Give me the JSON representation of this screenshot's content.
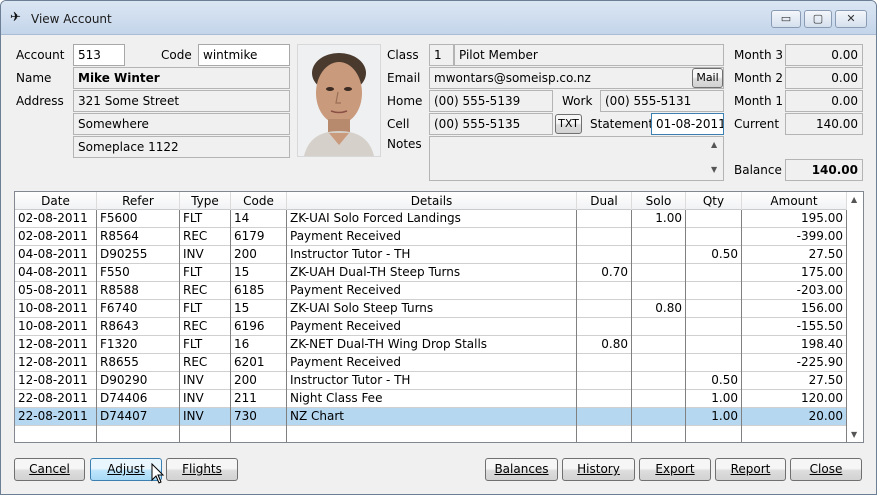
{
  "window": {
    "title": "View Account",
    "minimize": "▭",
    "maximize": "▢",
    "close": "✕"
  },
  "account": {
    "account_label": "Account",
    "account_value": "513",
    "code_label": "Code",
    "code_value": "wintmike",
    "name_label": "Name",
    "name_value": "Mike Winter",
    "address_label": "Address",
    "address_lines": [
      "321 Some Street",
      "Somewhere",
      "Someplace 1122"
    ]
  },
  "contact": {
    "class_label": "Class",
    "class_num": "1",
    "class_name": "Pilot Member",
    "email_label": "Email",
    "email_value": "mwontars@someisp.co.nz",
    "mail_button": "Mail",
    "home_label": "Home",
    "home_value": "(00) 555-5139",
    "work_label": "Work",
    "work_value": "(00) 555-5131",
    "cell_label": "Cell",
    "cell_value": "(00) 555-5135",
    "txt_button": "TXT",
    "statement_label": "Statement",
    "statement_value": "01-08-2011",
    "notes_label": "Notes",
    "notes_value": ""
  },
  "balances": {
    "month3_label": "Month 3",
    "month3_value": "0.00",
    "month2_label": "Month 2",
    "month2_value": "0.00",
    "month1_label": "Month 1",
    "month1_value": "0.00",
    "current_label": "Current",
    "current_value": "140.00",
    "balance_label": "Balance",
    "balance_value": "140.00"
  },
  "table": {
    "columns": [
      "Date",
      "Refer",
      "Type",
      "Code",
      "Details",
      "Dual",
      "Solo",
      "Qty",
      "Amount"
    ],
    "rows": [
      [
        "02-08-2011",
        "F5600",
        "FLT",
        "14",
        "ZK-UAI Solo  Forced Landings",
        "",
        "1.00",
        "",
        "195.00"
      ],
      [
        "02-08-2011",
        "R8564",
        "REC",
        "6179",
        "Payment Received",
        "",
        "",
        "",
        "-399.00"
      ],
      [
        "04-08-2011",
        "D90255",
        "INV",
        "200",
        "Instructor Tutor - TH",
        "",
        "",
        "0.50",
        "27.50"
      ],
      [
        "04-08-2011",
        "F550",
        "FLT",
        "15",
        "ZK-UAH Dual-TH  Steep Turns",
        "0.70",
        "",
        "",
        "175.00"
      ],
      [
        "05-08-2011",
        "R8588",
        "REC",
        "6185",
        "Payment Received",
        "",
        "",
        "",
        "-203.00"
      ],
      [
        "10-08-2011",
        "F6740",
        "FLT",
        "15",
        "ZK-UAI Solo  Steep Turns",
        "",
        "0.80",
        "",
        "156.00"
      ],
      [
        "10-08-2011",
        "R8643",
        "REC",
        "6196",
        "Payment Received",
        "",
        "",
        "",
        "-155.50"
      ],
      [
        "12-08-2011",
        "F1320",
        "FLT",
        "16",
        "ZK-NET Dual-TH  Wing Drop Stalls",
        "0.80",
        "",
        "",
        "198.40"
      ],
      [
        "12-08-2011",
        "R8655",
        "REC",
        "6201",
        "Payment Received",
        "",
        "",
        "",
        "-225.90"
      ],
      [
        "12-08-2011",
        "D90290",
        "INV",
        "200",
        "Instructor Tutor - TH",
        "",
        "",
        "0.50",
        "27.50"
      ],
      [
        "22-08-2011",
        "D74406",
        "INV",
        "211",
        "Night Class Fee",
        "",
        "",
        "1.00",
        "120.00"
      ],
      [
        "22-08-2011",
        "D74407",
        "INV",
        "730",
        "NZ Chart",
        "",
        "",
        "1.00",
        "20.00"
      ],
      [
        "",
        "",
        "",
        "",
        "",
        "",
        "",
        "",
        ""
      ]
    ],
    "selected_row": 11
  },
  "buttons": {
    "cancel": "Cancel",
    "adjust": "Adjust",
    "flights": "Flights",
    "balances": "Balances",
    "history": "History",
    "export": "Export",
    "report": "Report",
    "close": "Close"
  },
  "colors": {
    "selection": "#b5d7f0",
    "hover_button": "#bee6fd"
  }
}
